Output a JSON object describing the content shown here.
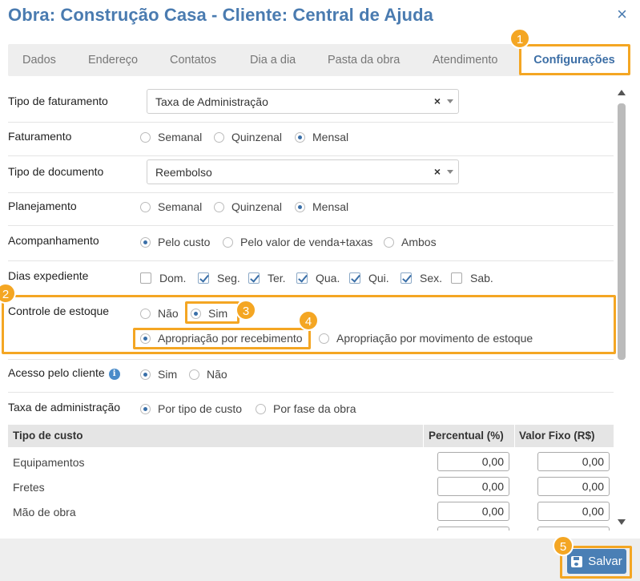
{
  "header": {
    "title": "Obra: Construção Casa - Cliente: Central de Ajuda",
    "close_icon": "×"
  },
  "tabs": [
    {
      "label": "Dados"
    },
    {
      "label": "Endereço"
    },
    {
      "label": "Contatos"
    },
    {
      "label": "Dia a dia"
    },
    {
      "label": "Pasta da obra"
    },
    {
      "label": "Atendimento"
    },
    {
      "label": "Configurações",
      "active": true
    }
  ],
  "form": {
    "tipo_faturamento": {
      "label": "Tipo de faturamento",
      "value": "Taxa de Administração",
      "clear": "×"
    },
    "faturamento": {
      "label": "Faturamento",
      "options": [
        "Semanal",
        "Quinzenal",
        "Mensal"
      ],
      "selected": "Mensal"
    },
    "tipo_documento": {
      "label": "Tipo de documento",
      "value": "Reembolso",
      "clear": "×"
    },
    "planejamento": {
      "label": "Planejamento",
      "options": [
        "Semanal",
        "Quinzenal",
        "Mensal"
      ],
      "selected": "Mensal"
    },
    "acompanhamento": {
      "label": "Acompanhamento",
      "options": [
        "Pelo custo",
        "Pelo valor de venda+taxas",
        "Ambos"
      ],
      "selected": "Pelo custo"
    },
    "dias_expediente": {
      "label": "Dias expediente",
      "days": [
        {
          "label": "Dom.",
          "checked": false
        },
        {
          "label": "Seg.",
          "checked": true
        },
        {
          "label": "Ter.",
          "checked": true
        },
        {
          "label": "Qua.",
          "checked": true
        },
        {
          "label": "Qui.",
          "checked": true
        },
        {
          "label": "Sex.",
          "checked": true
        },
        {
          "label": "Sab.",
          "checked": false
        }
      ]
    },
    "controle_estoque": {
      "label": "Controle de estoque",
      "options": [
        "Não",
        "Sim"
      ],
      "selected": "Sim",
      "apropriacao": {
        "options": [
          "Apropriação por recebimento",
          "Apropriação por movimento de estoque"
        ],
        "selected": "Apropriação por recebimento"
      }
    },
    "acesso_cliente": {
      "label": "Acesso pelo cliente",
      "info_icon": "i",
      "options": [
        "Sim",
        "Não"
      ],
      "selected": "Sim"
    },
    "taxa_administracao": {
      "label": "Taxa de administração",
      "options": [
        "Por tipo de custo",
        "Por fase da obra"
      ],
      "selected": "Por tipo de custo"
    }
  },
  "table": {
    "headers": [
      "Tipo de custo",
      "Percentual (%)",
      "Valor Fixo (R$)"
    ],
    "rows": [
      {
        "name": "Equipamentos",
        "percent": "0,00",
        "fixed": "0,00"
      },
      {
        "name": "Fretes",
        "percent": "0,00",
        "fixed": "0,00"
      },
      {
        "name": "Mão de obra",
        "percent": "0,00",
        "fixed": "0,00"
      }
    ]
  },
  "footer": {
    "save_label": "Salvar",
    "save_icon": "floppy-disk-icon"
  },
  "annotations": [
    "1",
    "2",
    "3",
    "4",
    "5"
  ],
  "colors": {
    "accent": "#4a7bb0",
    "highlight": "#f4a623",
    "button": "#4a7fb5"
  }
}
